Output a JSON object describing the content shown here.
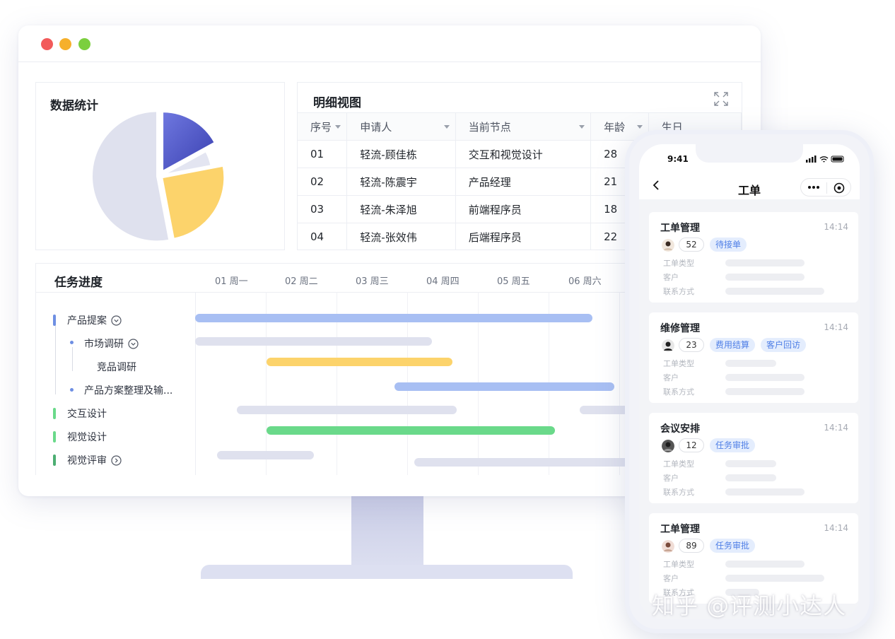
{
  "stats": {
    "title": "数据统计",
    "chart_data": {
      "type": "pie",
      "title": "数据统计",
      "values": [
        17,
        5,
        25,
        53
      ],
      "colors": [
        "#4a53c8",
        "#e3e5f1",
        "#fcd36b",
        "#dfe1ee"
      ]
    }
  },
  "detail": {
    "title": "明细视图",
    "columns": [
      "序号",
      "申请人",
      "当前节点",
      "年龄",
      "生日"
    ],
    "rows": [
      [
        "01",
        "轻流-顾佳栋",
        "交互和视觉设计",
        "28"
      ],
      [
        "02",
        "轻流-陈震宇",
        "产品经理",
        "21"
      ],
      [
        "03",
        "轻流-朱泽旭",
        "前端程序员",
        "18"
      ],
      [
        "04",
        "轻流-张效伟",
        "后端程序员",
        "22"
      ]
    ]
  },
  "gantt": {
    "title": "任务进度",
    "days": [
      "01 周一",
      "02 周二",
      "03 周三",
      "04 周四",
      "05 周五",
      "06 周六"
    ],
    "tasks": [
      {
        "label": "产品提案",
        "color": "#6e8fe3"
      },
      {
        "label": "市场调研",
        "color": "#6e8fe3"
      },
      {
        "label": "竞品调研",
        "color": ""
      },
      {
        "label": "产品方案整理及输...",
        "color": "#6e8fe3"
      },
      {
        "label": "交互设计",
        "color": "#6ad98a"
      },
      {
        "label": "视觉设计",
        "color": "#6ad98a"
      },
      {
        "label": "视觉评审",
        "color": "#4cae72"
      }
    ]
  },
  "phone": {
    "time": "9:41",
    "title": "工单",
    "field_labels": [
      "工单类型",
      "客户",
      "联系方式"
    ],
    "cards": [
      {
        "title": "工单管理",
        "time": "14:14",
        "count": "52",
        "tags": [
          "待接单"
        ]
      },
      {
        "title": "维修管理",
        "time": "14:14",
        "count": "23",
        "tags": [
          "费用结算",
          "客户回访"
        ]
      },
      {
        "title": "会议安排",
        "time": "14:14",
        "count": "12",
        "tags": [
          "任务审批"
        ]
      },
      {
        "title": "工单管理",
        "time": "14:14",
        "count": "89",
        "tags": [
          "任务审批"
        ]
      }
    ]
  },
  "watermark": "知乎 @评测小达人",
  "colors": {
    "accent": "#4a53c8",
    "bar_blue": "#a8bff3",
    "bar_gray": "#dfe1ee",
    "bar_yellow": "#fcd36b",
    "bar_green": "#6ad98a",
    "tag_bg": "#e4edfd",
    "tag_text": "#4f7fe6"
  }
}
